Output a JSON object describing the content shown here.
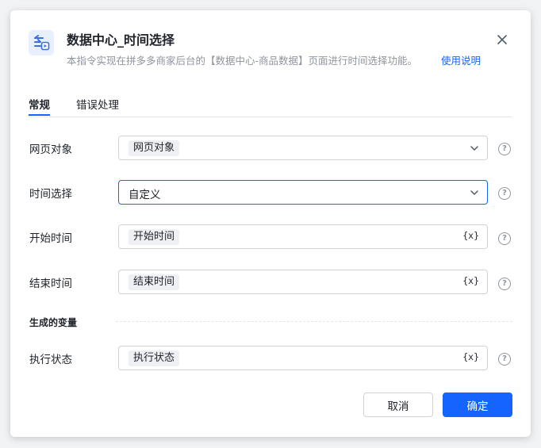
{
  "dialog": {
    "title": "数据中心_时间选择",
    "description": "本指令实现在拼多多商家后台的【数据中心-商品数据】页面进行时间选择功能。",
    "help_link": "使用说明"
  },
  "tabs": [
    {
      "label": "常规",
      "active": true
    },
    {
      "label": "错误处理",
      "active": false
    }
  ],
  "fields": {
    "web_object": {
      "label": "网页对象",
      "value": "网页对象",
      "type": "select-chip"
    },
    "time_select": {
      "label": "时间选择",
      "value": "自定义",
      "type": "select"
    },
    "start_time": {
      "label": "开始时间",
      "value": "开始时间",
      "type": "variable-chip"
    },
    "end_time": {
      "label": "结束时间",
      "value": "结束时间",
      "type": "variable-chip"
    }
  },
  "output_section": {
    "title": "生成的变量",
    "exec_status": {
      "label": "执行状态",
      "value": "执行状态"
    }
  },
  "variable_button_label": "{x}",
  "help_glyph": "?",
  "buttons": {
    "cancel": "取消",
    "confirm": "确定"
  },
  "icons": {
    "logo": "data-center-logo-icon",
    "close": "close-icon",
    "chevron": "chevron-down-icon",
    "help": "question-circle-icon"
  },
  "colors": {
    "accent": "#1664ff",
    "muted": "#8f959e",
    "border": "#d0d3d6"
  }
}
